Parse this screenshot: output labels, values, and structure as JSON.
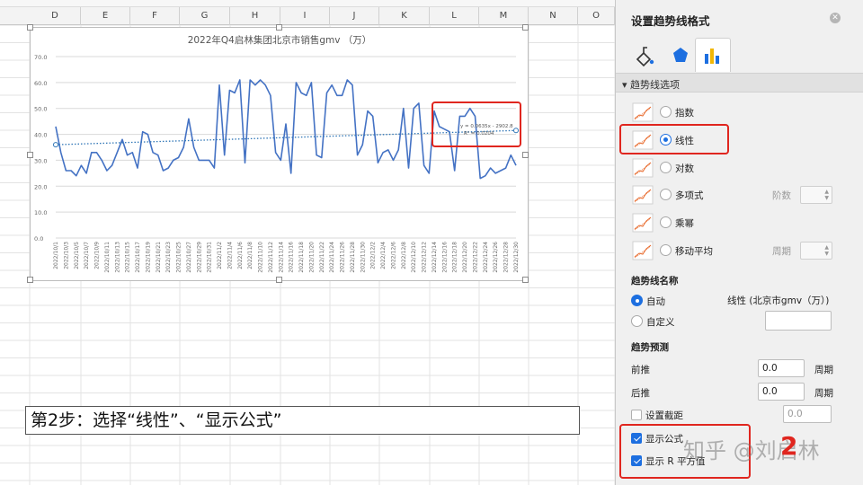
{
  "sheet": {
    "columns": [
      "D",
      "E",
      "F",
      "G",
      "H",
      "I",
      "J",
      "K",
      "L",
      "M",
      "N",
      "O"
    ]
  },
  "chart": {
    "title": "2022年Q4启林集团北京市销售gmv （万）",
    "trendline_label_line1": "y = 0.0635x - 2902.8",
    "trendline_label_line2": "R² = 0.0204",
    "colors": {
      "series": "#4472c4",
      "trend": "#2e75b6",
      "grid": "#d9d9d9"
    }
  },
  "chart_data": {
    "type": "line",
    "title": "2022年Q4启林集团北京市销售gmv （万）",
    "xlabel": "",
    "ylabel": "",
    "ylim": [
      0,
      70
    ],
    "yticks": [
      "0.0",
      "10.0",
      "20.0",
      "30.0",
      "40.0",
      "50.0",
      "60.0",
      "70.0"
    ],
    "x_tick_labels": [
      "2022/10/1",
      "2022/10/3",
      "2022/10/5",
      "2022/10/7",
      "2022/10/9",
      "2022/10/11",
      "2022/10/13",
      "2022/10/15",
      "2022/10/17",
      "2022/10/19",
      "2022/10/21",
      "2022/10/23",
      "2022/10/25",
      "2022/10/27",
      "2022/10/29",
      "2022/10/31",
      "2022/11/2",
      "2022/11/4",
      "2022/11/6",
      "2022/11/8",
      "2022/11/10",
      "2022/11/12",
      "2022/11/14",
      "2022/11/16",
      "2022/11/18",
      "2022/11/20",
      "2022/11/22",
      "2022/11/24",
      "2022/11/26",
      "2022/11/28",
      "2022/11/30",
      "2022/12/2",
      "2022/12/4",
      "2022/12/6",
      "2022/12/8",
      "2022/12/10",
      "2022/12/12",
      "2022/12/14",
      "2022/12/16",
      "2022/12/18",
      "2022/12/20",
      "2022/12/22",
      "2022/12/24",
      "2022/12/26",
      "2022/12/28",
      "2022/12/30"
    ],
    "series": [
      {
        "values": [
          43,
          33,
          26,
          26,
          24,
          28,
          25,
          33,
          33,
          30,
          26,
          28,
          33,
          38,
          32,
          33,
          27,
          41,
          40,
          33,
          32,
          26,
          27,
          30,
          31,
          35,
          46,
          35,
          30,
          30,
          30,
          27,
          59,
          32,
          57,
          56,
          61,
          29,
          61,
          59,
          61,
          59,
          55,
          33,
          30,
          44,
          25,
          60,
          56,
          55,
          60,
          32,
          31,
          56,
          59,
          55,
          55,
          61,
          59,
          32,
          36,
          49,
          47,
          29,
          33,
          34,
          30,
          34,
          50,
          27,
          50,
          52,
          28,
          25,
          49,
          43,
          42,
          41,
          26,
          47,
          47,
          50,
          47,
          23,
          24,
          27,
          25,
          26,
          27,
          32,
          28
        ],
        "line_style": "solid"
      }
    ],
    "trendline": {
      "type": "linear",
      "start": 36,
      "end": 41.5,
      "line_style": "dotted"
    }
  },
  "step": {
    "text": "第2步：选择“线性”、“显示公式”"
  },
  "panel": {
    "title": "设置趋势线格式",
    "section_label": "趋势线选项",
    "options": [
      {
        "label": "指数",
        "selected": false
      },
      {
        "label": "线性",
        "selected": true
      },
      {
        "label": "对数",
        "selected": false
      },
      {
        "label": "多项式",
        "selected": false,
        "extra": "阶数"
      },
      {
        "label": "乘幂",
        "selected": false
      },
      {
        "label": "移动平均",
        "selected": false,
        "extra": "周期"
      }
    ],
    "name_section": "趋势线名称",
    "name_auto": "自动",
    "name_auto_value": "线性 (北京市gmv（万）)",
    "name_custom": "自定义",
    "forecast_section": "趋势预测",
    "forward_label": "前推",
    "forward_value": "0.0",
    "forward_unit": "周期",
    "backward_label": "后推",
    "backward_value": "0.0",
    "backward_unit": "周期",
    "intercept_label": "设置截距",
    "intercept_value": "0.0",
    "show_formula_label": "显示公式",
    "show_r2_label": "显示 R 平方值"
  },
  "overlay": {
    "watermark": "知乎 @刘启林",
    "annotation_number": "2"
  }
}
